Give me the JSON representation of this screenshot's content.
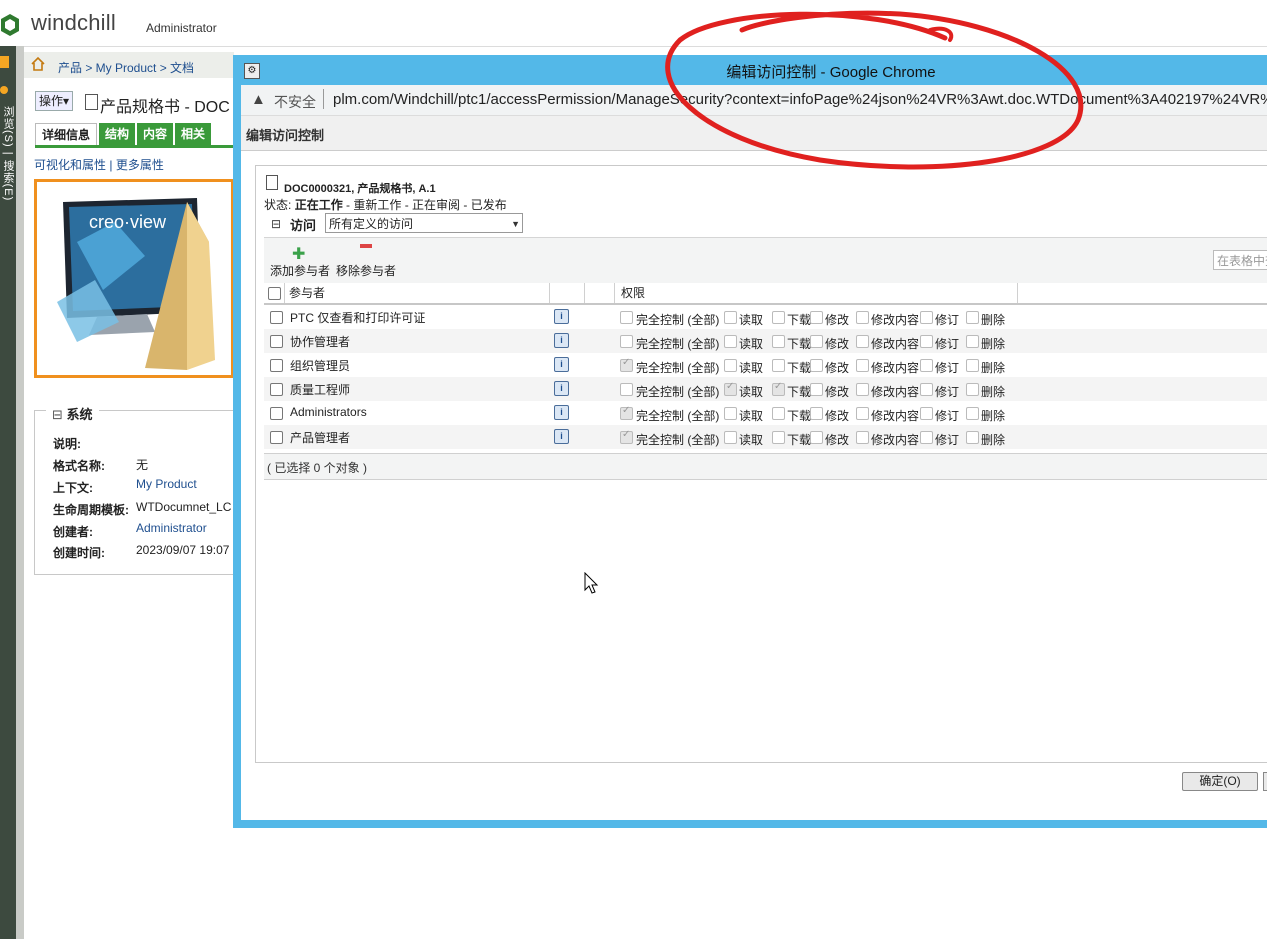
{
  "app": {
    "logo_text": "windchill",
    "user": "Administrator"
  },
  "left_strip": {
    "vertical_text": "浏览(S) | 搜索(E)"
  },
  "breadcrumb": {
    "text": "产品 > My Product > 文档"
  },
  "doc_header": {
    "action_label": "操作▾",
    "title": "产品规格书 - DOC"
  },
  "tabs": [
    {
      "label": "详细信息",
      "active": true
    },
    {
      "label": "结构",
      "active": false
    },
    {
      "label": "内容",
      "active": false
    },
    {
      "label": "相关",
      "active": false
    }
  ],
  "sub_links": {
    "visual": "可视化和属性",
    "sep": "|",
    "more": "更多属性"
  },
  "preview": {
    "brand": "creo·view"
  },
  "system": {
    "legend": "系统",
    "toggle": "⊟",
    "props": [
      {
        "label": "说明:",
        "value": "",
        "link": false
      },
      {
        "label": "格式名称:",
        "value": "无",
        "link": false
      },
      {
        "label": "上下文:",
        "value": "My Product",
        "link": true
      },
      {
        "label": "生命周期模板:",
        "value": "WTDocumnet_LC",
        "link": false
      },
      {
        "label": "创建者:",
        "value": "Administrator",
        "link": true
      },
      {
        "label": "创建时间:",
        "value": "2023/09/07 19:07",
        "link": false
      }
    ]
  },
  "popup": {
    "title": "编辑访问控制 - Google Chrome",
    "address": {
      "warning_icon": "▲",
      "insecure": "不安全",
      "url": "plm.com/Windchill/ptc1/accessPermission/ManageSecurity?context=infoPage%24json%24VR%3Awt.doc.WTDocument%3A402197%24VR%"
    },
    "page_heading": "编辑访问控制",
    "object": {
      "name": "DOC0000321, 产品规格书, A.1",
      "state_label": "状态:",
      "state_current": "正在工作",
      "state_rest": "- 重新工作 - 正在审阅 - 已发布"
    },
    "access": {
      "toggle": "⊟",
      "label": "访问",
      "select_value": "所有定义的访问"
    },
    "toolbar": {
      "add_label": "添加参与者",
      "remove_label": "移除参与者",
      "search_placeholder": "在表格中查找"
    },
    "table": {
      "col_participant": "参与者",
      "col_permission": "权限",
      "perm_names": [
        "完全控制 (全部)",
        "读取",
        "下载",
        "修改",
        "修改内容",
        "修订",
        "删除"
      ],
      "rows": [
        {
          "name": "PTC 仅查看和打印许可证",
          "perms": [
            false,
            false,
            false,
            false,
            false,
            false,
            false
          ]
        },
        {
          "name": "协作管理者",
          "perms": [
            false,
            false,
            false,
            false,
            false,
            false,
            false
          ]
        },
        {
          "name": "组织管理员",
          "perms": [
            true,
            false,
            false,
            false,
            false,
            false,
            false
          ]
        },
        {
          "name": "质量工程师",
          "perms": [
            false,
            true,
            true,
            false,
            false,
            false,
            false
          ]
        },
        {
          "name": "Administrators",
          "perms": [
            true,
            false,
            false,
            false,
            false,
            false,
            false
          ]
        },
        {
          "name": "产品管理者",
          "perms": [
            true,
            false,
            false,
            false,
            false,
            false,
            false
          ]
        }
      ],
      "footer": "( 已选择 0 个对象 )"
    },
    "ok_label": "确定(O)"
  },
  "colors": {
    "popup_frame": "#53b8e8",
    "tab_green": "#3a9a3a",
    "preview_border": "#f0901e",
    "annotation_red": "#e0211f"
  }
}
